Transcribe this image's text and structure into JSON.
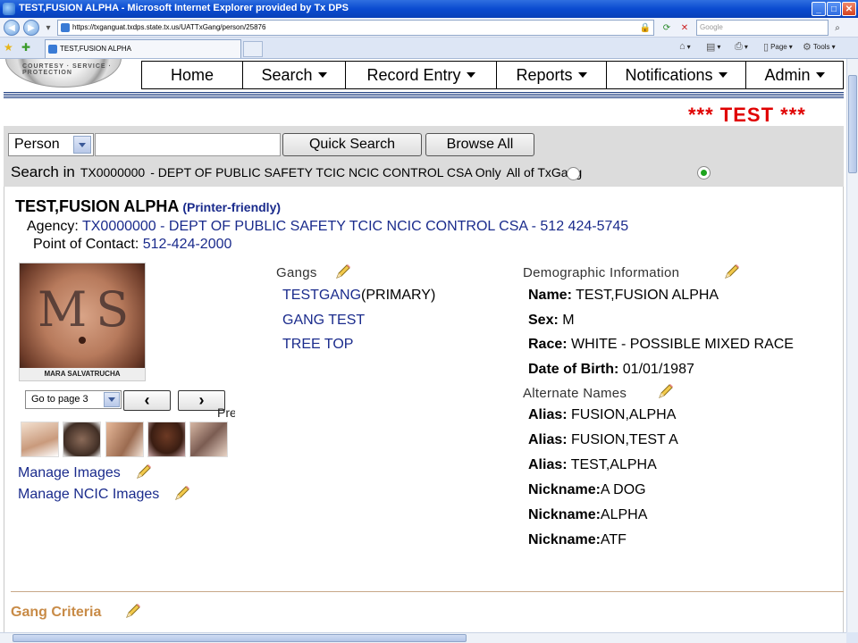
{
  "window": {
    "title": "TEST,FUSION ALPHA - Microsoft Internet Explorer provided by Tx DPS",
    "minimize": "_",
    "maximize": "□",
    "close": "✕"
  },
  "browser": {
    "url": "https://txganguat.txdps.state.tx.us/UATTxGang/person/25876",
    "search_placeholder": "Google",
    "tab_title": "TEST,FUSION ALPHA",
    "page_menu": "Page",
    "tools_menu": "Tools"
  },
  "nav": {
    "items": [
      {
        "label": "Home",
        "dropdown": false
      },
      {
        "label": "Search",
        "dropdown": true
      },
      {
        "label": "Record Entry",
        "dropdown": true
      },
      {
        "label": "Reports",
        "dropdown": true
      },
      {
        "label": "Notifications",
        "dropdown": true
      },
      {
        "label": "Admin",
        "dropdown": true
      }
    ]
  },
  "banner": "*** TEST ***",
  "search": {
    "type_selected": "Person",
    "query": "",
    "quick_search": "Quick Search",
    "browse_all": "Browse All",
    "search_in_label": "Search in",
    "agency_code": "TX0000000",
    "agency_desc": "- DEPT OF PUBLIC SAFETY TCIC NCIC CONTROL CSA Only",
    "all_of_txgang": "All of TxGang",
    "selected_scope": "all_of_txgang"
  },
  "person": {
    "name": "TEST,FUSION ALPHA",
    "printer_friendly": "(Printer-friendly)",
    "agency_label": "Agency:",
    "agency": "TX0000000 - DEPT OF PUBLIC SAFETY TCIC NCIC CONTROL CSA - 512 424-5745",
    "poc_label": "Point of Contact:",
    "poc": "512-424-2000"
  },
  "images": {
    "main_caption": "MARA SALVATRUCHA",
    "main_tattoo_text": "MS",
    "page_select": "Go to page 3",
    "prev": "‹",
    "next": "›",
    "previous_fragment": "Pre",
    "manage_images": "Manage Images",
    "manage_ncic_images": "Manage NCIC Images"
  },
  "gangs": {
    "heading": "Gangs",
    "items": [
      {
        "name": "TESTGANG",
        "suffix": "(PRIMARY)"
      },
      {
        "name": "GANG TEST",
        "suffix": ""
      },
      {
        "name": "TREE TOP",
        "suffix": ""
      }
    ]
  },
  "demographics": {
    "heading": "Demographic Information",
    "rows": [
      {
        "label": "Name:",
        "value": "TEST,FUSION ALPHA"
      },
      {
        "label": "Sex:",
        "value": "M"
      },
      {
        "label": "Race:",
        "value": "WHITE - POSSIBLE MIXED RACE"
      },
      {
        "label": "Date of Birth:",
        "value": "01/01/1987"
      }
    ]
  },
  "alternate_names": {
    "heading": "Alternate Names",
    "rows": [
      {
        "label": "Alias:",
        "value": "FUSION,ALPHA"
      },
      {
        "label": "Alias:",
        "value": "FUSION,TEST A"
      },
      {
        "label": "Alias:",
        "value": "TEST,ALPHA"
      },
      {
        "label": "Nickname:",
        "value": "A DOG"
      },
      {
        "label": "Nickname:",
        "value": "ALPHA"
      },
      {
        "label": "Nickname:",
        "value": "ATF"
      }
    ]
  },
  "gang_criteria": {
    "heading": "Gang Criteria"
  }
}
